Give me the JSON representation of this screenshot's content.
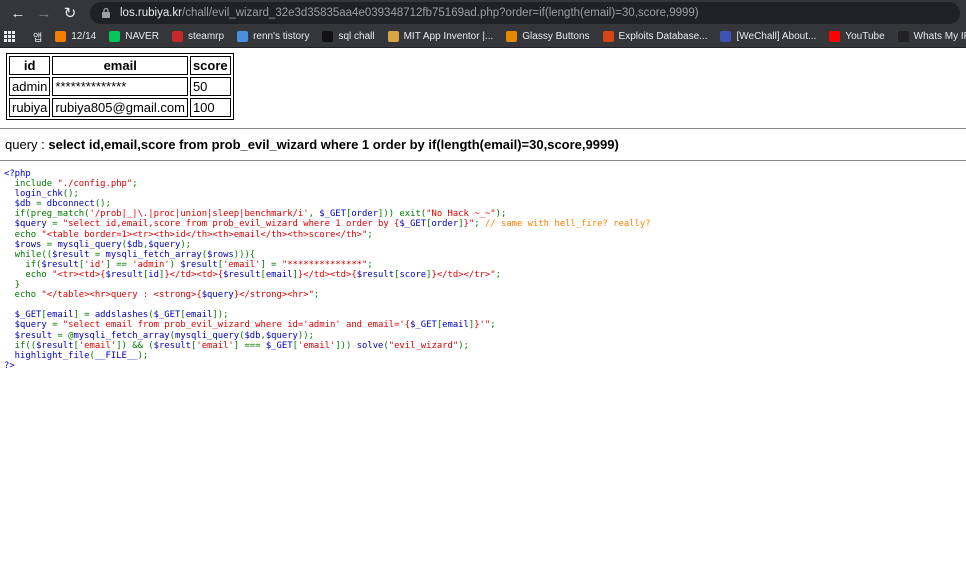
{
  "browser": {
    "url_host": "los.rubiya.kr",
    "url_path": "/chall/evil_wizard_32e3d35835aa4e039348712fb75169ad.php?order=if(length(email)=30,score,9999)",
    "bookmarks": [
      {
        "label": "",
        "icon": "apps-grid-icon",
        "color": "#e8eaed"
      },
      {
        "label": "앱",
        "icon": "",
        "color": ""
      },
      {
        "label": "12/14",
        "icon": "blogger-icon",
        "color": "#f57d00"
      },
      {
        "label": "NAVER",
        "icon": "naver-icon",
        "color": "#03c75a"
      },
      {
        "label": "steamrp",
        "icon": "steam-icon",
        "color": "#c62828"
      },
      {
        "label": "renn's tistory",
        "icon": "tistory-icon",
        "color": "#4a90e2"
      },
      {
        "label": "sql chall",
        "icon": "z-icon",
        "color": "#111111"
      },
      {
        "label": "MIT App Inventor |...",
        "icon": "app-inventor-icon",
        "color": "#d9a441"
      },
      {
        "label": "Glassy Buttons",
        "icon": "glassy-icon",
        "color": "#e58a00"
      },
      {
        "label": "Exploits Database...",
        "icon": "exploit-db-icon",
        "color": "#d84315"
      },
      {
        "label": "[WeChall] About...",
        "icon": "wechall-icon",
        "color": "#3f51b5"
      },
      {
        "label": "YouTube",
        "icon": "youtube-icon",
        "color": "#ff0000"
      },
      {
        "label": "Whats My IP Addr...",
        "icon": "ip-icon",
        "color": "#222222"
      }
    ]
  },
  "results_table": {
    "headers": [
      "id",
      "email",
      "score"
    ],
    "rows": [
      [
        "admin",
        "**************",
        "50"
      ],
      [
        "rubiya",
        "rubiya805@gmail.com",
        "100"
      ]
    ]
  },
  "query": {
    "label": "query : ",
    "sql": "select id,email,score from prob_evil_wizard where 1 order by if(length(email)=30,score,9999)"
  },
  "source": {
    "lines": [
      [
        [
          "default",
          "<?php"
        ]
      ],
      [
        [
          "keyword",
          "  include "
        ],
        [
          "string",
          "\"./config.php\""
        ],
        [
          "keyword",
          ";"
        ]
      ],
      [
        [
          "default",
          "  login_chk"
        ],
        [
          "keyword",
          "();"
        ]
      ],
      [
        [
          "default",
          "  $db "
        ],
        [
          "keyword",
          "= "
        ],
        [
          "default",
          "dbconnect"
        ],
        [
          "keyword",
          "();"
        ]
      ],
      [
        [
          "keyword",
          "  if(preg_match("
        ],
        [
          "string",
          "'/prob|_|\\.|proc|union|sleep|benchmark/i'"
        ],
        [
          "keyword",
          ", "
        ],
        [
          "default",
          "$_GET"
        ],
        [
          "keyword",
          "["
        ],
        [
          "default",
          "order"
        ],
        [
          "keyword",
          "])) exit("
        ],
        [
          "string",
          "\"No Hack ~_~\""
        ],
        [
          "keyword",
          ");"
        ]
      ],
      [
        [
          "default",
          "  $query "
        ],
        [
          "keyword",
          "= "
        ],
        [
          "string",
          "\"select id,email,score from prob_evil_wizard where 1 order by {"
        ],
        [
          "default",
          "$_GET"
        ],
        [
          "keyword",
          "["
        ],
        [
          "default",
          "order"
        ],
        [
          "keyword",
          "]"
        ],
        [
          "string",
          "}\""
        ],
        [
          "keyword",
          "; "
        ],
        [
          "comment",
          "// same with hell_fire? really?"
        ]
      ],
      [
        [
          "keyword",
          "  echo "
        ],
        [
          "string",
          "\"<table border=1><tr><th>id</th><th>email</th><th>score</th>\""
        ],
        [
          "keyword",
          ";"
        ]
      ],
      [
        [
          "default",
          "  $rows "
        ],
        [
          "keyword",
          "= "
        ],
        [
          "default",
          "mysqli_query"
        ],
        [
          "keyword",
          "("
        ],
        [
          "default",
          "$db"
        ],
        [
          "keyword",
          ","
        ],
        [
          "default",
          "$query"
        ],
        [
          "keyword",
          ");"
        ]
      ],
      [
        [
          "keyword",
          "  while(("
        ],
        [
          "default",
          "$result "
        ],
        [
          "keyword",
          "= "
        ],
        [
          "default",
          "mysqli_fetch_array"
        ],
        [
          "keyword",
          "("
        ],
        [
          "default",
          "$rows"
        ],
        [
          "keyword",
          "))){"
        ]
      ],
      [
        [
          "keyword",
          "    if("
        ],
        [
          "default",
          "$result"
        ],
        [
          "keyword",
          "["
        ],
        [
          "string",
          "'id'"
        ],
        [
          "keyword",
          "] == "
        ],
        [
          "string",
          "'admin'"
        ],
        [
          "keyword",
          ") "
        ],
        [
          "default",
          "$result"
        ],
        [
          "keyword",
          "["
        ],
        [
          "string",
          "'email'"
        ],
        [
          "keyword",
          "] = "
        ],
        [
          "string",
          "\"**************\""
        ],
        [
          "keyword",
          ";"
        ]
      ],
      [
        [
          "keyword",
          "    echo "
        ],
        [
          "string",
          "\"<tr><td>{"
        ],
        [
          "default",
          "$result"
        ],
        [
          "keyword",
          "["
        ],
        [
          "default",
          "id"
        ],
        [
          "keyword",
          "]"
        ],
        [
          "string",
          "}</td><td>{"
        ],
        [
          "default",
          "$result"
        ],
        [
          "keyword",
          "["
        ],
        [
          "default",
          "email"
        ],
        [
          "keyword",
          "]"
        ],
        [
          "string",
          "}</td><td>{"
        ],
        [
          "default",
          "$result"
        ],
        [
          "keyword",
          "["
        ],
        [
          "default",
          "score"
        ],
        [
          "keyword",
          "]"
        ],
        [
          "string",
          "}</td></tr>\""
        ],
        [
          "keyword",
          ";"
        ]
      ],
      [
        [
          "keyword",
          "  }"
        ]
      ],
      [
        [
          "keyword",
          "  echo "
        ],
        [
          "string",
          "\"</table><hr>query : <strong>{"
        ],
        [
          "default",
          "$query"
        ],
        [
          "string",
          "}</strong><hr>\""
        ],
        [
          "keyword",
          ";"
        ]
      ],
      [
        [
          "default",
          ""
        ]
      ],
      [
        [
          "default",
          "  $_GET"
        ],
        [
          "keyword",
          "["
        ],
        [
          "default",
          "email"
        ],
        [
          "keyword",
          "] = "
        ],
        [
          "default",
          "addslashes"
        ],
        [
          "keyword",
          "("
        ],
        [
          "default",
          "$_GET"
        ],
        [
          "keyword",
          "["
        ],
        [
          "default",
          "email"
        ],
        [
          "keyword",
          "]);"
        ]
      ],
      [
        [
          "default",
          "  $query "
        ],
        [
          "keyword",
          "= "
        ],
        [
          "string",
          "\"select email from prob_evil_wizard where id='admin' and email='{"
        ],
        [
          "default",
          "$_GET"
        ],
        [
          "keyword",
          "["
        ],
        [
          "default",
          "email"
        ],
        [
          "keyword",
          "]"
        ],
        [
          "string",
          "}'\""
        ],
        [
          "keyword",
          ";"
        ]
      ],
      [
        [
          "default",
          "  $result "
        ],
        [
          "keyword",
          "= @"
        ],
        [
          "default",
          "mysqli_fetch_array"
        ],
        [
          "keyword",
          "("
        ],
        [
          "default",
          "mysqli_query"
        ],
        [
          "keyword",
          "("
        ],
        [
          "default",
          "$db"
        ],
        [
          "keyword",
          ","
        ],
        [
          "default",
          "$query"
        ],
        [
          "keyword",
          "));"
        ]
      ],
      [
        [
          "keyword",
          "  if(("
        ],
        [
          "default",
          "$result"
        ],
        [
          "keyword",
          "["
        ],
        [
          "string",
          "'email'"
        ],
        [
          "keyword",
          "]) && ("
        ],
        [
          "default",
          "$result"
        ],
        [
          "keyword",
          "["
        ],
        [
          "string",
          "'email'"
        ],
        [
          "keyword",
          "] === "
        ],
        [
          "default",
          "$_GET"
        ],
        [
          "keyword",
          "["
        ],
        [
          "string",
          "'email'"
        ],
        [
          "keyword",
          "])) "
        ],
        [
          "default",
          "solve"
        ],
        [
          "keyword",
          "("
        ],
        [
          "string",
          "\"evil_wizard\""
        ],
        [
          "keyword",
          ");"
        ]
      ],
      [
        [
          "default",
          "  highlight_file"
        ],
        [
          "keyword",
          "("
        ],
        [
          "default",
          "__FILE__"
        ],
        [
          "keyword",
          ");"
        ]
      ],
      [
        [
          "default",
          "?>"
        ]
      ]
    ]
  }
}
